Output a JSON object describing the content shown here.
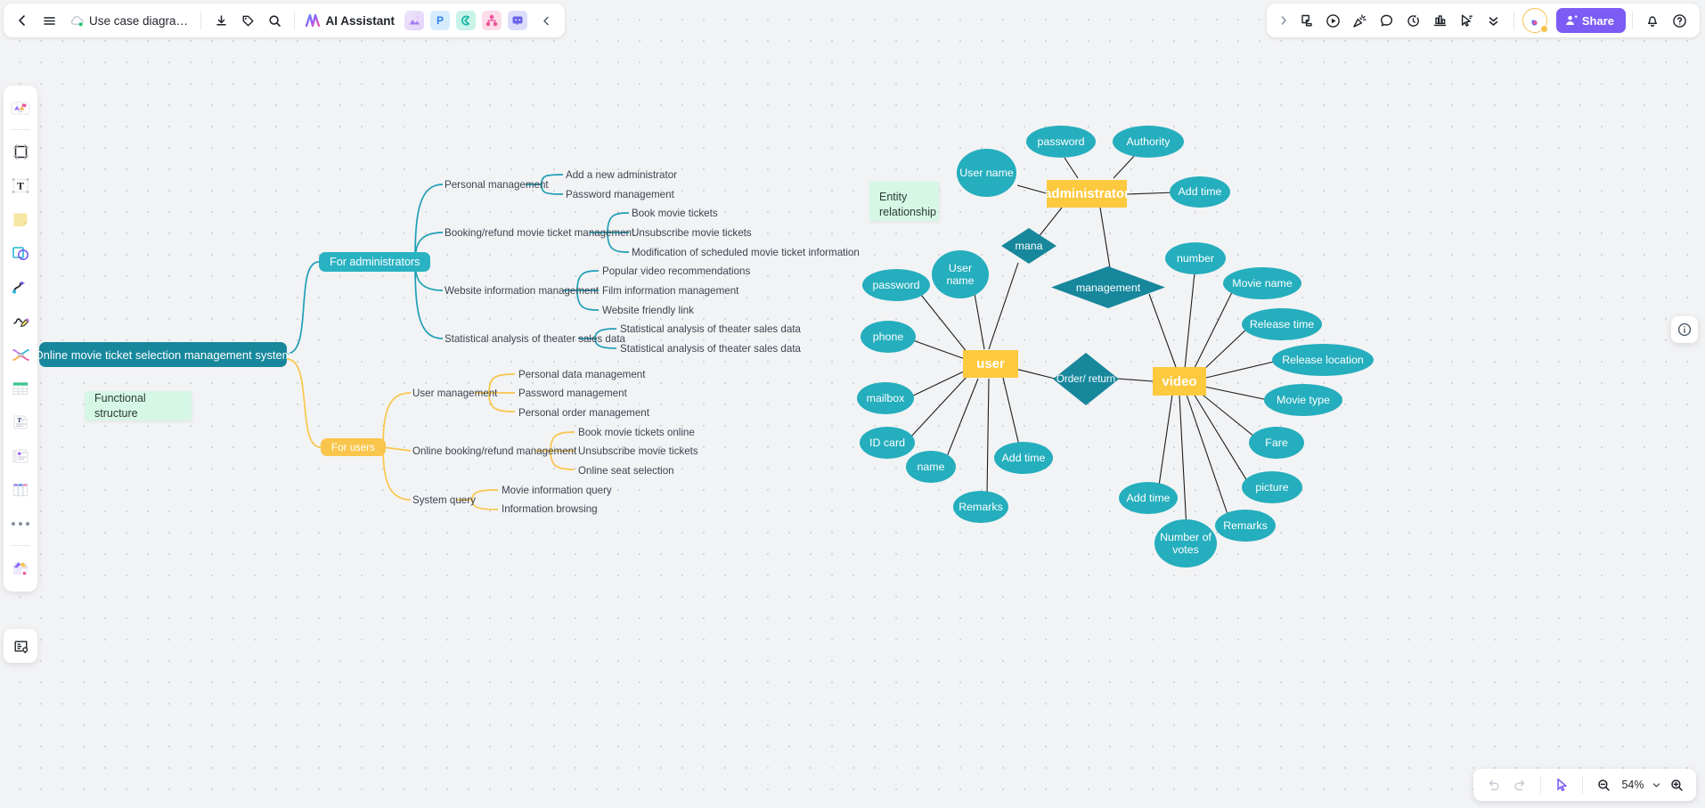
{
  "app": {
    "document_title": "Use case diagram of onli...",
    "ai_assistant_label": "AI Assistant",
    "share_label": "Share",
    "zoom_level": "54%"
  },
  "toolbar_left": {
    "back_icon": "chevron-left-icon",
    "menu_icon": "hamburger-menu-icon",
    "cloud_icon": "cloud-saved-icon",
    "download_icon": "download-icon",
    "tag_icon": "tag-icon",
    "search_icon": "search-icon",
    "apps": [
      {
        "name": "image-generator-chip",
        "label": ""
      },
      {
        "name": "presentation-chip",
        "label": "P"
      },
      {
        "name": "flowchart-chip",
        "label": "C"
      },
      {
        "name": "mindmap-chip",
        "label": ""
      },
      {
        "name": "comment-chip",
        "label": ""
      }
    ],
    "collapse_icon": "chevron-left-icon"
  },
  "toolbar_right": {
    "expand_icon": "chevron-right-icon",
    "items": [
      {
        "name": "sticky-note-icon"
      },
      {
        "name": "media-play-icon"
      },
      {
        "name": "confetti-icon"
      },
      {
        "name": "comment-bubble-icon"
      },
      {
        "name": "timer-icon"
      },
      {
        "name": "vote-chart-icon"
      },
      {
        "name": "cursor-flag-icon"
      },
      {
        "name": "more-chevrons-icon"
      }
    ],
    "brand_badge": "boardmix-avatar",
    "share_icon": "person-share-icon",
    "notification_icon": "bell-icon",
    "help_icon": "question-circle-icon"
  },
  "left_rail": {
    "items": [
      {
        "name": "rail-item-templates",
        "icon": "template-gallery-icon"
      },
      {
        "name": "rail-item-frame",
        "icon": "frame-icon"
      },
      {
        "name": "rail-item-text",
        "icon": "text-box-icon"
      },
      {
        "name": "rail-item-sticky-note",
        "icon": "sticky-note-icon"
      },
      {
        "name": "rail-item-shapes",
        "icon": "shapes-icon"
      },
      {
        "name": "rail-item-connector",
        "icon": "curve-connector-icon"
      },
      {
        "name": "rail-item-pen",
        "icon": "pencil-draw-icon"
      },
      {
        "name": "rail-item-mindmap",
        "icon": "mindmap-icon"
      },
      {
        "name": "rail-item-table",
        "icon": "table-icon"
      },
      {
        "name": "rail-item-document",
        "icon": "text-document-icon"
      },
      {
        "name": "rail-item-cards",
        "icon": "card-stack-icon"
      },
      {
        "name": "rail-item-kanban",
        "icon": "kanban-board-icon"
      },
      {
        "name": "rail-item-more",
        "icon": "more-dots-icon"
      },
      {
        "name": "rail-item-plugins",
        "icon": "plugin-box-icon"
      }
    ],
    "bottom_item": {
      "name": "rail-item-presentation-notes",
      "icon": "notes-pin-icon"
    }
  },
  "bottom_bar": {
    "undo_icon": "undo-icon",
    "redo_icon": "redo-icon",
    "cursor_icon": "cursor-pointer-icon",
    "zoom_out_icon": "zoom-out-icon",
    "zoom_in_icon": "zoom-in-icon",
    "zoom_caret_icon": "chevron-down-icon"
  },
  "right_panel": {
    "info_icon": "info-circle-icon"
  },
  "mindmap": {
    "root": "Online movie ticket selection management system",
    "sticky_label": "Functional structure",
    "branches": [
      {
        "label": "For administrators",
        "color": "#29b2c2",
        "children": [
          {
            "label": "Personal management",
            "children": [
              "Add a new administrator",
              "Password management"
            ]
          },
          {
            "label": "Booking/refund movie ticket management",
            "children": [
              "Book movie tickets",
              "Unsubscribe movie tickets",
              "Modification of scheduled movie ticket information"
            ]
          },
          {
            "label": "Website information management",
            "children": [
              "Popular video recommendations",
              "Film information management",
              "Website friendly link"
            ]
          },
          {
            "label": "Statistical analysis of theater sales data",
            "children": [
              "Statistical analysis of theater sales data",
              "Statistical analysis of theater sales data"
            ]
          }
        ]
      },
      {
        "label": "For users",
        "color": "#f9c64b",
        "children": [
          {
            "label": "User management",
            "children": [
              "Personal data management",
              "Password management",
              "Personal order management"
            ]
          },
          {
            "label": "Online booking/refund management",
            "children": [
              "Book movie tickets online",
              "Unsubscribe movie tickets",
              "Online seat selection"
            ]
          },
          {
            "label": "System query",
            "children": [
              "Movie information query",
              "Information browsing"
            ]
          }
        ]
      }
    ]
  },
  "er_diagram": {
    "sticky_label": "Entity relationship",
    "entities": [
      {
        "name": "administrator",
        "type": "rect"
      },
      {
        "name": "user",
        "type": "rect"
      },
      {
        "name": "video",
        "type": "rect"
      }
    ],
    "relationships": [
      {
        "name": "mana",
        "type": "diamond"
      },
      {
        "name": "management",
        "type": "diamond"
      },
      {
        "name": "Order/ return",
        "type": "diamond"
      }
    ],
    "attributes": [
      {
        "name": "User name",
        "of": "administrator"
      },
      {
        "name": "password",
        "of": "administrator"
      },
      {
        "name": "Authority",
        "of": "administrator"
      },
      {
        "name": "Add time",
        "of": "administrator"
      },
      {
        "name": "User name",
        "of": "user"
      },
      {
        "name": "password",
        "of": "user"
      },
      {
        "name": "phone",
        "of": "user"
      },
      {
        "name": "mailbox",
        "of": "user"
      },
      {
        "name": "ID card",
        "of": "user"
      },
      {
        "name": "name",
        "of": "user"
      },
      {
        "name": "Remarks",
        "of": "user"
      },
      {
        "name": "Add time",
        "of": "user"
      },
      {
        "name": "number",
        "of": "video"
      },
      {
        "name": "Movie name",
        "of": "video"
      },
      {
        "name": "Release time",
        "of": "video"
      },
      {
        "name": "Release location",
        "of": "video"
      },
      {
        "name": "Movie type",
        "of": "video"
      },
      {
        "name": "Fare",
        "of": "video"
      },
      {
        "name": "picture",
        "of": "video"
      },
      {
        "name": "Remarks",
        "of": "video"
      },
      {
        "name": "Number of votes",
        "of": "video"
      },
      {
        "name": "Add time",
        "of": "video"
      }
    ]
  }
}
